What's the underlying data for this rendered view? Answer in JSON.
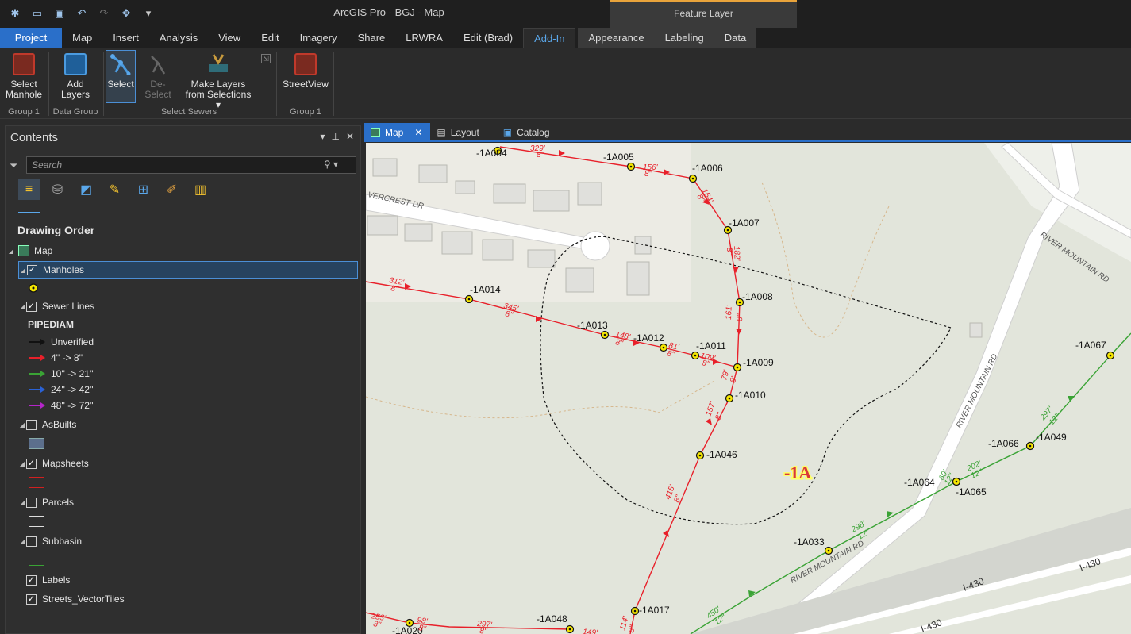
{
  "app": {
    "title": "ArcGIS Pro - BGJ - Map",
    "contextual_tab_group": "Feature Layer"
  },
  "tabs": [
    "Project",
    "Map",
    "Insert",
    "Analysis",
    "View",
    "Edit",
    "Imagery",
    "Share",
    "LRWRA",
    "Edit (Brad)",
    "Add-In",
    "Appearance",
    "Labeling",
    "Data"
  ],
  "ribbon": {
    "buttons": [
      {
        "label1": "Select",
        "label2": "Manhole",
        "group": "Group 1"
      },
      {
        "label1": "Add",
        "label2": "Layers",
        "group": "Data Group"
      },
      {
        "label1": "Select",
        "label2": ""
      },
      {
        "label1": "De-Select",
        "label2": ""
      },
      {
        "label1": "Make Layers",
        "label2": "from Selections ▾"
      },
      {
        "label1": "StreetView",
        "label2": "",
        "group": "Group 1"
      }
    ],
    "group_select_sewers": "Select Sewers"
  },
  "contents": {
    "title": "Contents",
    "search_placeholder": "Search",
    "drawing_order": "Drawing Order",
    "map_label": "Map",
    "layers": [
      {
        "name": "Manholes",
        "checked": true
      },
      {
        "name": "Sewer Lines",
        "checked": true
      },
      {
        "name": "AsBuilts",
        "checked": false
      },
      {
        "name": "Mapsheets",
        "checked": true
      },
      {
        "name": "Parcels",
        "checked": false
      },
      {
        "name": "Subbasin",
        "checked": false
      },
      {
        "name": "Labels",
        "checked": true
      },
      {
        "name": "Streets_VectorTiles",
        "checked": true
      }
    ],
    "pipediam": {
      "title": "PIPEDIAM",
      "items": [
        {
          "label": "Unverified",
          "color": "#111111"
        },
        {
          "label": "4'' -> 8''",
          "color": "#e8202a"
        },
        {
          "label": "10'' -> 21''",
          "color": "#3aa335"
        },
        {
          "label": "24'' -> 42''",
          "color": "#2a62d6"
        },
        {
          "label": "48'' -> 72''",
          "color": "#b425c9"
        }
      ]
    }
  },
  "view_tabs": [
    "Map",
    "Layout",
    "Catalog"
  ],
  "map": {
    "subbasin_label": "-1A",
    "streets": [
      "VERCREST DR",
      "RIVER MOUNTAIN RD",
      "RIVER MOUNTAIN RD",
      "RIVER MOUNTAIN RD",
      "I-430",
      "I-430",
      "I-430"
    ],
    "manholes": [
      "-1A004",
      "-1A005",
      "-1A006",
      "-1A007",
      "-1A008",
      "-1A009",
      "-1A010",
      "-1A046",
      "-1A014",
      "-1A013",
      "-1A012",
      "-1A011",
      "-1A017",
      "-1A048",
      "-1A020",
      "-1A033",
      "-1A064",
      "-1A065",
      "-1A066",
      "-1A049",
      "-1A067"
    ],
    "pipe_labels": [
      "329'",
      "8''",
      "156'",
      "8''",
      "154'",
      "8''",
      "182'",
      "8''",
      "161'",
      "8''",
      "79'",
      "8''",
      "157'",
      "8''",
      "415'",
      "8''",
      "114'",
      "8''",
      "312'",
      "8''",
      "345'",
      "8''",
      "148'",
      "8''",
      "81'",
      "8''",
      "109'",
      "8''",
      "253'",
      "8''",
      "98'",
      "8''",
      "297'",
      "8''",
      "149'",
      "298'",
      "12''",
      "202'",
      "12''",
      "60'",
      "12''",
      "297'",
      "12''",
      "450'",
      "12''"
    ]
  }
}
